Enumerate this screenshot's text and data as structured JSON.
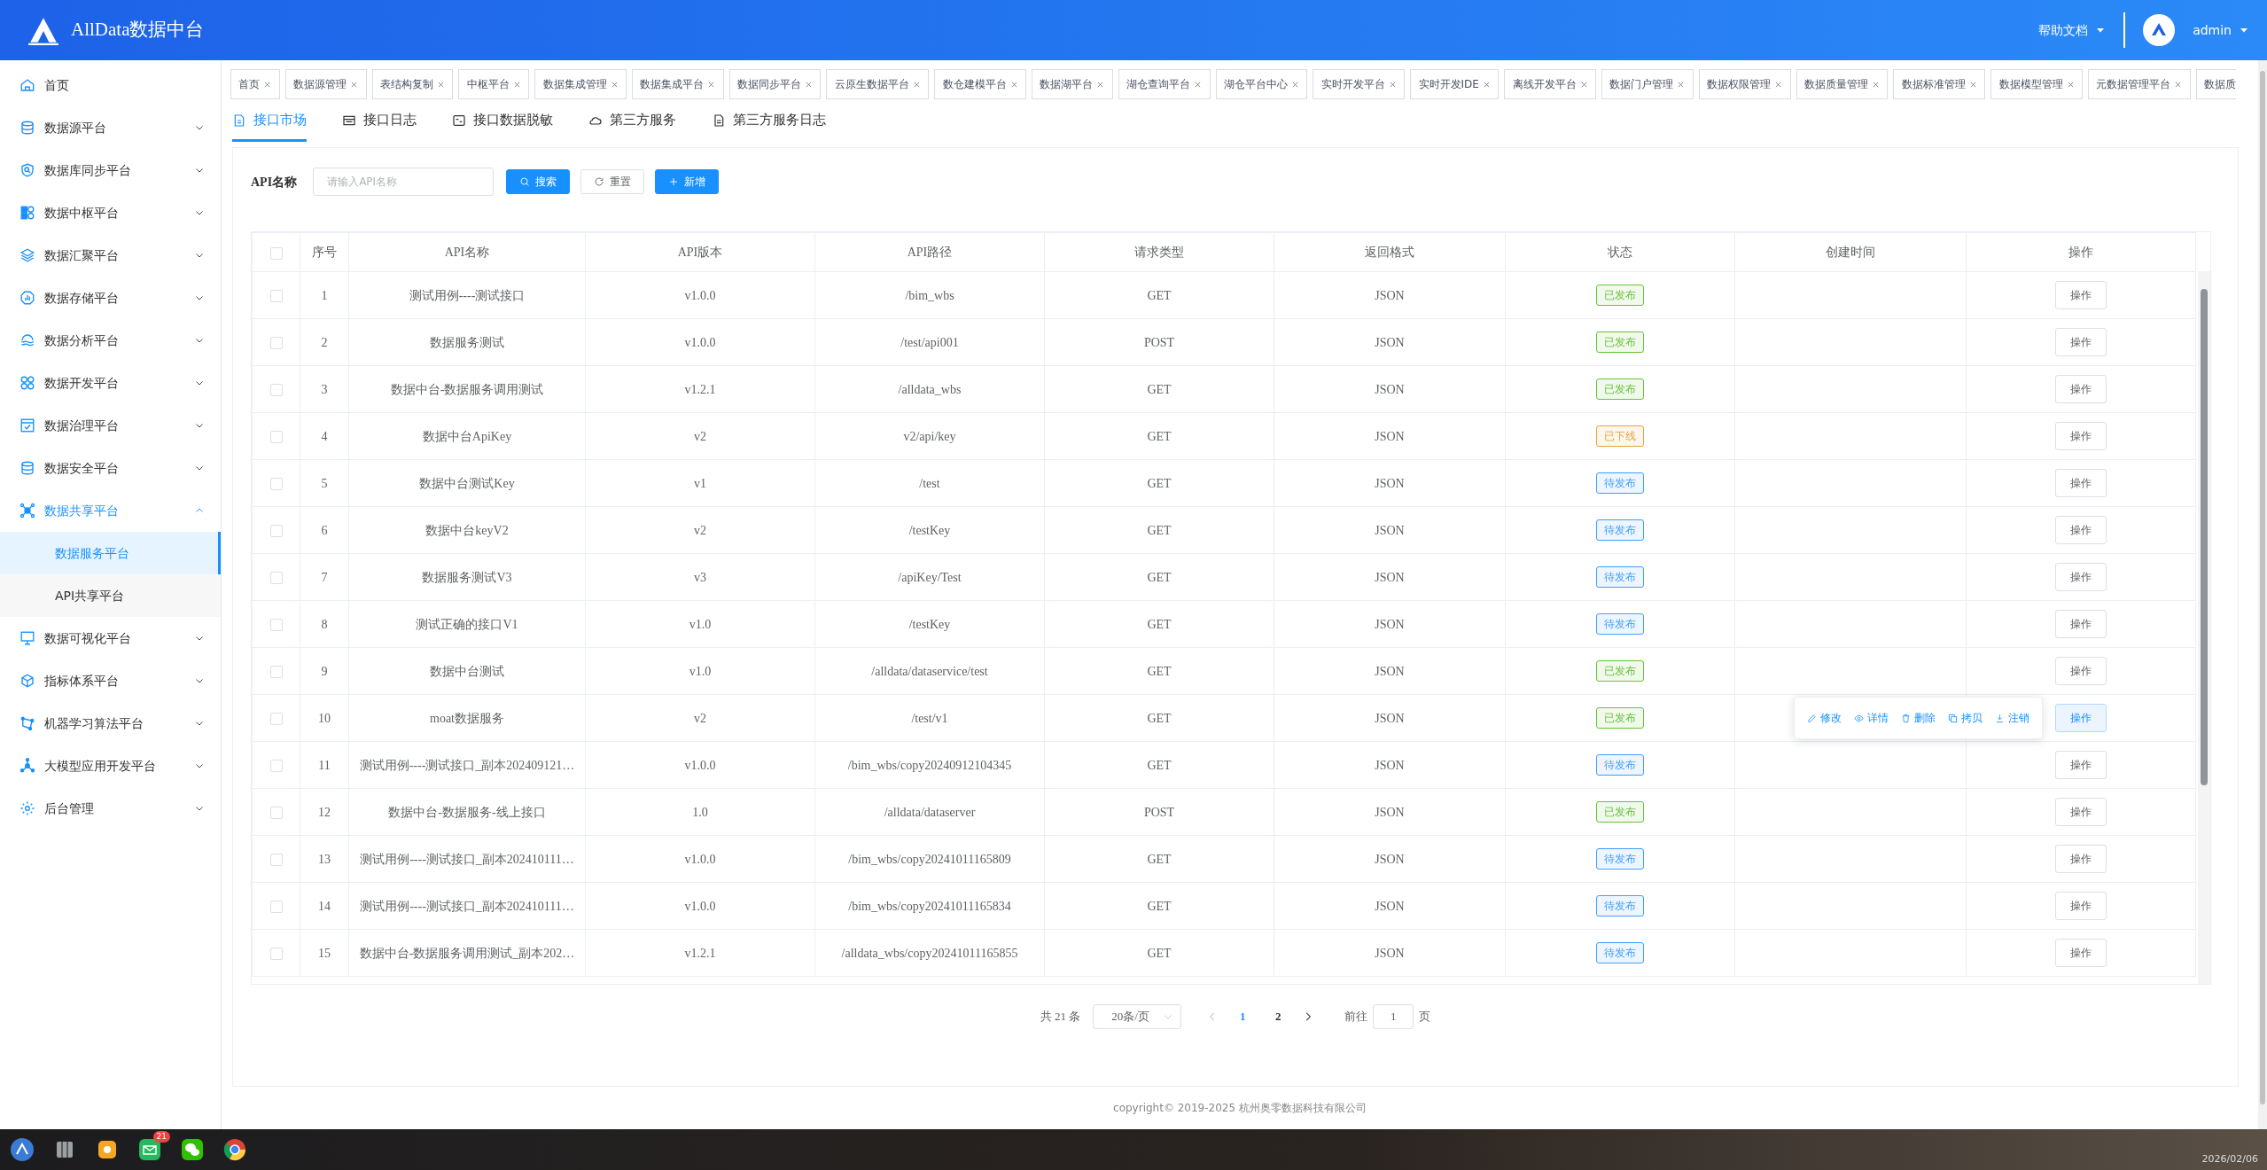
{
  "header": {
    "brand": "AllData数据中台",
    "help": "帮助文档",
    "user": "admin"
  },
  "sidebar": {
    "items": [
      {
        "label": "首页"
      },
      {
        "label": "数据源平台",
        "expanded": false
      },
      {
        "label": "数据库同步平台",
        "expanded": false
      },
      {
        "label": "数据中枢平台",
        "expanded": false
      },
      {
        "label": "数据汇聚平台",
        "expanded": false
      },
      {
        "label": "数据存储平台",
        "expanded": false
      },
      {
        "label": "数据分析平台",
        "expanded": false
      },
      {
        "label": "数据开发平台",
        "expanded": false
      },
      {
        "label": "数据治理平台",
        "expanded": false
      },
      {
        "label": "数据安全平台",
        "expanded": false
      },
      {
        "label": "数据共享平台",
        "expanded": true,
        "children": [
          {
            "label": "数据服务平台",
            "selected": true
          },
          {
            "label": "API共享平台",
            "selected": false
          }
        ]
      },
      {
        "label": "数据可视化平台",
        "expanded": false
      },
      {
        "label": "指标体系平台",
        "expanded": false
      },
      {
        "label": "机器学习算法平台",
        "expanded": false
      },
      {
        "label": "大模型应用开发平台",
        "expanded": false
      },
      {
        "label": "后台管理",
        "expanded": false
      }
    ]
  },
  "page_tabs": [
    {
      "label": "首页",
      "selected": false
    },
    {
      "label": "数据源管理",
      "selected": false
    },
    {
      "label": "表结构复制",
      "selected": false
    },
    {
      "label": "中枢平台",
      "selected": false
    },
    {
      "label": "数据集成管理",
      "selected": false
    },
    {
      "label": "数据集成平台",
      "selected": false
    },
    {
      "label": "数据同步平台",
      "selected": false
    },
    {
      "label": "云原生数据平台",
      "selected": false
    },
    {
      "label": "数仓建模平台",
      "selected": false
    },
    {
      "label": "数据湖平台",
      "selected": false
    },
    {
      "label": "湖仓查询平台",
      "selected": false
    },
    {
      "label": "湖仓平台中心",
      "selected": false
    },
    {
      "label": "实时开发平台",
      "selected": false
    },
    {
      "label": "实时开发IDE",
      "selected": false
    },
    {
      "label": "离线开发平台",
      "selected": false
    },
    {
      "label": "数据门户管理",
      "selected": false
    },
    {
      "label": "数据权限管理",
      "selected": false
    },
    {
      "label": "数据质量管理",
      "selected": false
    },
    {
      "label": "数据标准管理",
      "selected": false
    },
    {
      "label": "数据模型管理",
      "selected": false
    },
    {
      "label": "元数据管理平台",
      "selected": false
    },
    {
      "label": "数据质",
      "selected": false,
      "cut": true
    }
  ],
  "sub_tabs": [
    {
      "label": "接口市场",
      "selected": true
    },
    {
      "label": "接口日志",
      "selected": false
    },
    {
      "label": "接口数据脱敏",
      "selected": false
    },
    {
      "label": "第三方服务",
      "selected": false
    },
    {
      "label": "第三方服务日志",
      "selected": false
    }
  ],
  "search": {
    "label": "API名称",
    "placeholder": "请输入API名称",
    "buttons": [
      {
        "label": "搜索",
        "kind": "search"
      },
      {
        "label": "重置",
        "kind": "reset"
      },
      {
        "label": "新增",
        "kind": "add"
      }
    ]
  },
  "table": {
    "columns": [
      "序号",
      "API名称",
      "API版本",
      "API路径",
      "请求类型",
      "返回格式",
      "状态",
      "创建时间",
      "操作"
    ],
    "all_checked": false,
    "rows": [
      {
        "checked": false,
        "no": "1",
        "name": "测试用例----测试接口",
        "version": "v1.0.0",
        "path": "/bim_wbs",
        "method": "GET",
        "format": "JSON",
        "status": "已发布",
        "color": "#67c23a",
        "action": "操作",
        "op_active": false
      },
      {
        "checked": false,
        "no": "2",
        "name": "数据服务测试",
        "version": "v1.0.0",
        "path": "/test/api001",
        "method": "POST",
        "format": "JSON",
        "status": "已发布",
        "color": "#67c23a",
        "action": "操作",
        "op_active": false
      },
      {
        "checked": false,
        "no": "3",
        "name": "数据中台-数据服务调用测试",
        "version": "v1.2.1",
        "path": "/alldata_wbs",
        "method": "GET",
        "format": "JSON",
        "status": "已发布",
        "color": "#67c23a",
        "action": "操作",
        "op_active": false
      },
      {
        "checked": false,
        "no": "4",
        "name": "数据中台ApiKey",
        "version": "v2",
        "path": "v2/api/key",
        "method": "GET",
        "format": "JSON",
        "status": "已下线",
        "color": "#e6a23c",
        "action": "操作",
        "op_active": false
      },
      {
        "checked": false,
        "no": "5",
        "name": "数据中台测试Key",
        "version": "v1",
        "path": "/test",
        "method": "GET",
        "format": "JSON",
        "status": "待发布",
        "color": "#409eff",
        "action": "操作",
        "op_active": false
      },
      {
        "checked": false,
        "no": "6",
        "name": "数据中台keyV2",
        "version": "v2",
        "path": "/testKey",
        "method": "GET",
        "format": "JSON",
        "status": "待发布",
        "color": "#409eff",
        "action": "操作",
        "op_active": false
      },
      {
        "checked": false,
        "no": "7",
        "name": "数据服务测试V3",
        "version": "v3",
        "path": "/apiKey/Test",
        "method": "GET",
        "format": "JSON",
        "status": "待发布",
        "color": "#409eff",
        "action": "操作",
        "op_active": false
      },
      {
        "checked": false,
        "no": "8",
        "name": "测试正确的接口V1",
        "version": "v1.0",
        "path": "/testKey",
        "method": "GET",
        "format": "JSON",
        "status": "待发布",
        "color": "#409eff",
        "action": "操作",
        "op_active": false
      },
      {
        "checked": false,
        "no": "9",
        "name": "数据中台测试",
        "version": "v1.0",
        "path": "/alldata/dataservice/test",
        "method": "GET",
        "format": "JSON",
        "status": "已发布",
        "color": "#67c23a",
        "action": "操作",
        "op_active": false
      },
      {
        "checked": false,
        "no": "10",
        "name": "moat数据服务",
        "version": "v2",
        "path": "/test/v1",
        "method": "GET",
        "format": "JSON",
        "status": "已发布",
        "color": "#67c23a",
        "action": "操作",
        "op_active": true,
        "menu": [
          {
            "label": "修改",
            "kind": "edit"
          },
          {
            "label": "详情",
            "kind": "view"
          },
          {
            "label": "删除",
            "kind": "delete"
          },
          {
            "label": "拷贝",
            "kind": "copy"
          },
          {
            "label": "注销",
            "kind": "download"
          }
        ]
      },
      {
        "checked": false,
        "no": "11",
        "name": "测试用例----测试接口_副本202409121…",
        "version": "v1.0.0",
        "path": "/bim_wbs/copy20240912104345",
        "method": "GET",
        "format": "JSON",
        "status": "待发布",
        "color": "#409eff",
        "action": "操作",
        "op_active": false
      },
      {
        "checked": false,
        "no": "12",
        "name": "数据中台-数据服务-线上接口",
        "version": "1.0",
        "path": "/alldata/dataserver",
        "method": "POST",
        "format": "JSON",
        "status": "已发布",
        "color": "#67c23a",
        "action": "操作",
        "op_active": false
      },
      {
        "checked": false,
        "no": "13",
        "name": "测试用例----测试接口_副本202410111…",
        "version": "v1.0.0",
        "path": "/bim_wbs/copy20241011165809",
        "method": "GET",
        "format": "JSON",
        "status": "待发布",
        "color": "#409eff",
        "action": "操作",
        "op_active": false
      },
      {
        "checked": false,
        "no": "14",
        "name": "测试用例----测试接口_副本202410111…",
        "version": "v1.0.0",
        "path": "/bim_wbs/copy20241011165834",
        "method": "GET",
        "format": "JSON",
        "status": "待发布",
        "color": "#409eff",
        "action": "操作",
        "op_active": false
      },
      {
        "checked": false,
        "no": "15",
        "name": "数据中台-数据服务调用测试_副本202…",
        "version": "v1.2.1",
        "path": "/alldata_wbs/copy20241011165855",
        "method": "GET",
        "format": "JSON",
        "status": "待发布",
        "color": "#409eff",
        "action": "操作",
        "op_active": false
      }
    ]
  },
  "pagination": {
    "total": "共 21 条",
    "page_size": "20条/页",
    "pages": [
      {
        "label": "1",
        "selected": true
      },
      {
        "label": "2",
        "selected": false
      }
    ],
    "goto_label": "前往",
    "goto_value": "1",
    "goto_suffix": "页"
  },
  "footer": "copyright© 2019-2025 杭州奥零数据科技有限公司",
  "taskbar": {
    "mail_badge": "21",
    "date": "2026/02/06"
  }
}
